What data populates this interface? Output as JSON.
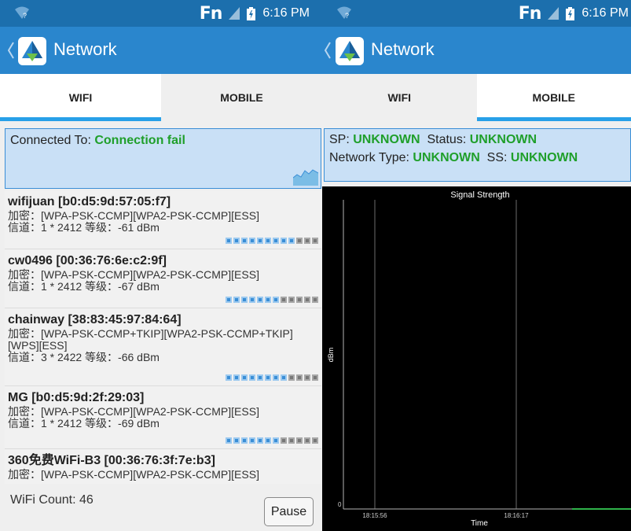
{
  "status_bar": {
    "fn": "Fn",
    "time": "6:16 PM"
  },
  "app_bar": {
    "title": "Network"
  },
  "tabs": [
    {
      "label": "WIFI"
    },
    {
      "label": "MOBILE"
    }
  ],
  "wifi": {
    "connected_label": "Connected To:",
    "connected_value": "Connection fail",
    "networks": [
      {
        "name": "wifijuan [b0:d5:9d:57:05:f7]",
        "enc": "加密：[WPA-PSK-CCMP][WPA2-PSK-CCMP][ESS]",
        "chan": "信道：1 * 2412    等级：-61 dBm",
        "strength": 9
      },
      {
        "name": "cw0496 [00:36:76:6e:c2:9f]",
        "enc": "加密：[WPA-PSK-CCMP][WPA2-PSK-CCMP][ESS]",
        "chan": "信道：1 * 2412    等级：-67 dBm",
        "strength": 7
      },
      {
        "name": "chainway [38:83:45:97:84:64]",
        "enc": "加密：[WPA-PSK-CCMP+TKIP][WPA2-PSK-CCMP+TKIP][WPS][ESS]",
        "chan": "信道：3 * 2422    等级：-66 dBm",
        "strength": 8
      },
      {
        "name": "MG [b0:d5:9d:2f:29:03]",
        "enc": "加密：[WPA-PSK-CCMP][WPA2-PSK-CCMP][ESS]",
        "chan": "信道：1 * 2412    等级：-69 dBm",
        "strength": 7
      },
      {
        "name": "360免费WiFi-B3 [00:36:76:3f:7e:b3]",
        "enc": "加密：[WPA-PSK-CCMP][WPA2-PSK-CCMP][ESS]",
        "chan": "",
        "strength": 0
      }
    ],
    "count_label": "WiFi Count:",
    "count_value": "46",
    "pause_label": "Pause"
  },
  "mobile": {
    "sp_label": "SP:",
    "sp_value": "UNKNOWN",
    "status_label": "Status:",
    "status_value": "UNKNOWN",
    "nettype_label": "Network Type:",
    "nettype_value": "UNKNOWN",
    "ss_label": "SS:",
    "ss_value": "UNKNOWN"
  },
  "chart_data": {
    "type": "line",
    "title": "Signal Strength",
    "xlabel": "Time",
    "ylabel": "dBm",
    "y_tick_labels": [
      "0"
    ],
    "x_tick_labels": [
      "18:15:56",
      "18:16:17"
    ],
    "series": [
      {
        "x": [
          "18:16:17"
        ],
        "values": [
          0
        ]
      }
    ]
  },
  "colors": {
    "accent": "#2a86cd",
    "status_bar": "#1c6fad",
    "ok_green": "#1f9f2a",
    "tab_indicator": "#28a0e8"
  }
}
